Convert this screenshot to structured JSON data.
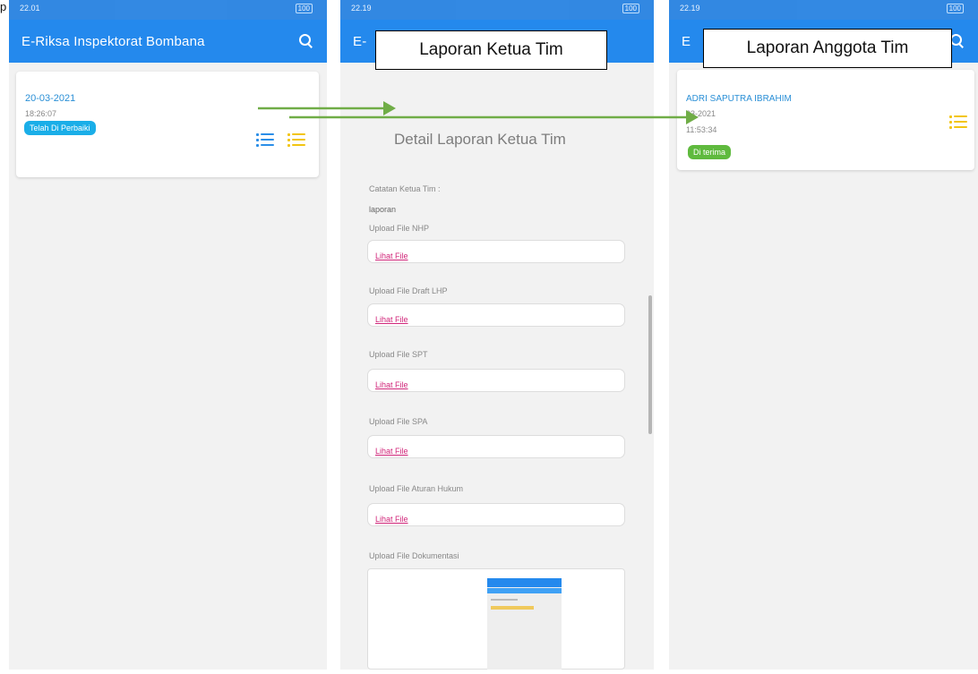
{
  "screens": {
    "list": {
      "status_time": "22.01",
      "battery": "100",
      "app_title": "E-Riksa Inspektorat Bombana",
      "card": {
        "date": "20-03-2021",
        "time": "18:26:07",
        "badge": "Telah Di Perbaiki"
      }
    },
    "detail": {
      "status_time": "22.19",
      "battery": "100",
      "app_title_fragment": "E-",
      "heading": "Detail Laporan Ketua Tim",
      "note_label": "Catatan Ketua Tim :",
      "note_value": "laporan",
      "link_text": "Lihat File",
      "uploads": [
        {
          "label": "Upload File NHP",
          "link": "Lihat File"
        },
        {
          "label": "Upload File Draft LHP",
          "link": "Lihat File"
        },
        {
          "label": "Upload File SPT",
          "link": "Lihat File"
        },
        {
          "label": "Upload File SPA",
          "link": "Lihat File"
        },
        {
          "label": "Upload File Aturan Hukum",
          "link": "Lihat File"
        }
      ],
      "doc_label": "Upload File Dokumentasi"
    },
    "member": {
      "status_time": "22.19",
      "battery": "100",
      "app_title_fragment": "E",
      "card": {
        "name": "ADRI SAPUTRA IBRAHIM",
        "date": "03-2021",
        "time": "11:53:34",
        "badge": "Di terima"
      }
    }
  },
  "annotations": {
    "label_ketua": "Laporan Ketua Tim",
    "label_anggota": "Laporan Anggota Tim",
    "corner_text": "p"
  },
  "colors": {
    "appbar": "#2489ed",
    "accent_text": "#2a8fd6",
    "badge_blue": "#1aaee8",
    "badge_green": "#5fba3e",
    "link": "#d1267a",
    "arrow": "#70ad47",
    "list_icon_yellow": "#f2c511"
  },
  "icons": [
    "search-icon",
    "list-icon",
    "wifi-icon"
  ]
}
